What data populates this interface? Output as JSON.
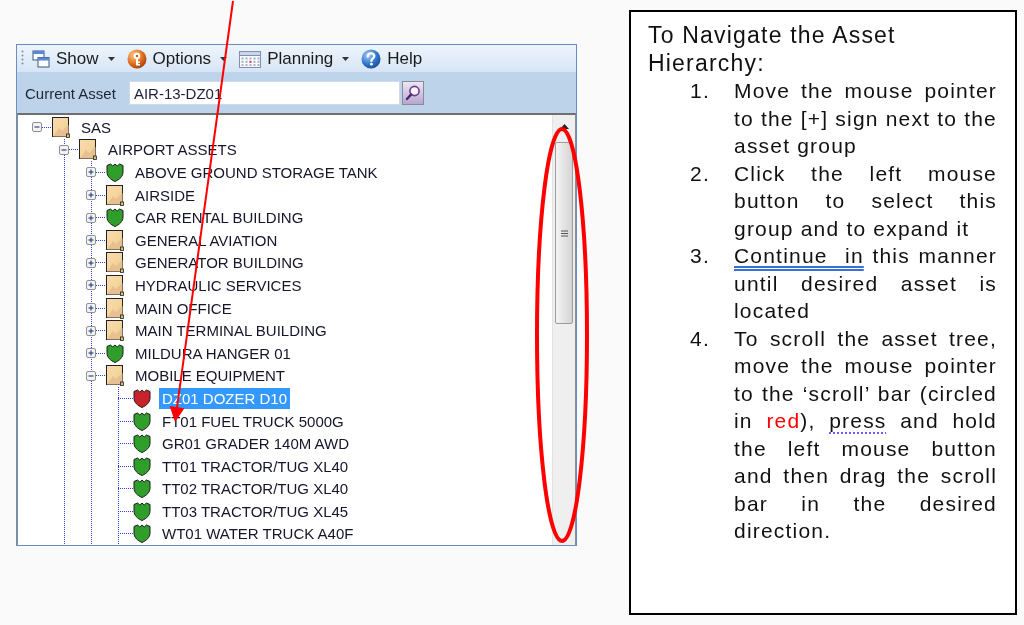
{
  "toolbar": {
    "items": [
      {
        "label": "Show",
        "dropdown": true
      },
      {
        "label": "Options",
        "dropdown": true
      },
      {
        "label": "Planning",
        "dropdown": true
      },
      {
        "label": "Help",
        "dropdown": false
      }
    ]
  },
  "current_asset": {
    "label": "Current Asset",
    "value": "AIR-13-DZ01"
  },
  "tree": {
    "nodes": [
      {
        "label": "SAS",
        "kind": "folder",
        "expanded": true,
        "selected": false,
        "children": [
          {
            "label": "AIRPORT ASSETS",
            "kind": "folder",
            "expanded": true,
            "selected": false,
            "children": [
              {
                "label": "ABOVE GROUND STORAGE TANK",
                "kind": "shield",
                "color": "#2f9e2a",
                "expanded": false,
                "selected": false
              },
              {
                "label": "AIRSIDE",
                "kind": "folder",
                "expanded": false,
                "selected": false
              },
              {
                "label": "CAR RENTAL BUILDING",
                "kind": "shield",
                "color": "#2f9e2a",
                "expanded": false,
                "selected": false
              },
              {
                "label": "GENERAL AVIATION",
                "kind": "folder",
                "expanded": false,
                "selected": false
              },
              {
                "label": "GENERATOR BUILDING",
                "kind": "folder",
                "expanded": false,
                "selected": false
              },
              {
                "label": "HYDRAULIC SERVICES",
                "kind": "folder",
                "expanded": false,
                "selected": false
              },
              {
                "label": "MAIN OFFICE",
                "kind": "folder",
                "expanded": false,
                "selected": false
              },
              {
                "label": "MAIN TERMINAL BUILDING",
                "kind": "folder",
                "expanded": false,
                "selected": false
              },
              {
                "label": "MILDURA HANGER 01",
                "kind": "shield",
                "color": "#2f9e2a",
                "expanded": false,
                "selected": false
              },
              {
                "label": "MOBILE EQUIPMENT",
                "kind": "folder",
                "expanded": true,
                "selected": false,
                "children": [
                  {
                    "label": "DZ01 DOZER D10",
                    "kind": "shield",
                    "color": "#c8232a",
                    "selected": true
                  },
                  {
                    "label": "FT01 FUEL TRUCK 5000G",
                    "kind": "shield",
                    "color": "#2f9e2a",
                    "selected": false
                  },
                  {
                    "label": "GR01 GRADER 140M AWD",
                    "kind": "shield",
                    "color": "#2f9e2a",
                    "selected": false
                  },
                  {
                    "label": "TT01 TRACTOR/TUG XL40",
                    "kind": "shield",
                    "color": "#2f9e2a",
                    "selected": false
                  },
                  {
                    "label": "TT02 TRACTOR/TUG XL40",
                    "kind": "shield",
                    "color": "#2f9e2a",
                    "selected": false
                  },
                  {
                    "label": "TT03 TRACTOR/TUG XL45",
                    "kind": "shield",
                    "color": "#2f9e2a",
                    "selected": false
                  },
                  {
                    "label": "WT01 WATER TRUCK A40F",
                    "kind": "shield",
                    "color": "#2f9e2a",
                    "selected": false
                  }
                ]
              }
            ]
          }
        ]
      }
    ]
  },
  "instructions": {
    "title": "To Navigate the Asset Hierarchy:",
    "steps": [
      {
        "number": "1.",
        "segments": [
          {
            "text": "Move the mouse pointer to the [+] sign next to the asset group",
            "kind": "plain"
          }
        ]
      },
      {
        "number": "2.",
        "segments": [
          {
            "text": "Click the left mouse button to select this group and to expand it",
            "kind": "plain"
          }
        ]
      },
      {
        "number": "3.",
        "segments": [
          {
            "text": "Continue  in",
            "kind": "grammar"
          },
          {
            "text": " this manner until desired asset is located",
            "kind": "plain"
          }
        ]
      },
      {
        "number": "4.",
        "segments": [
          {
            "text": "To scroll the asset tree, move the mouse pointer to the ‘scroll’ bar (circled in ",
            "kind": "plain"
          },
          {
            "text": "red",
            "kind": "plain",
            "color": "#ff0000"
          },
          {
            "text": "), ",
            "kind": "plain"
          },
          {
            "text": "press",
            "kind": "suggestion"
          },
          {
            "text": " and hold the left mouse button and then drag the scroll bar in the desired direction.",
            "kind": "plain"
          }
        ]
      }
    ]
  },
  "annotations": [
    {
      "kind": "arrow"
    },
    {
      "kind": "ellipse"
    }
  ]
}
